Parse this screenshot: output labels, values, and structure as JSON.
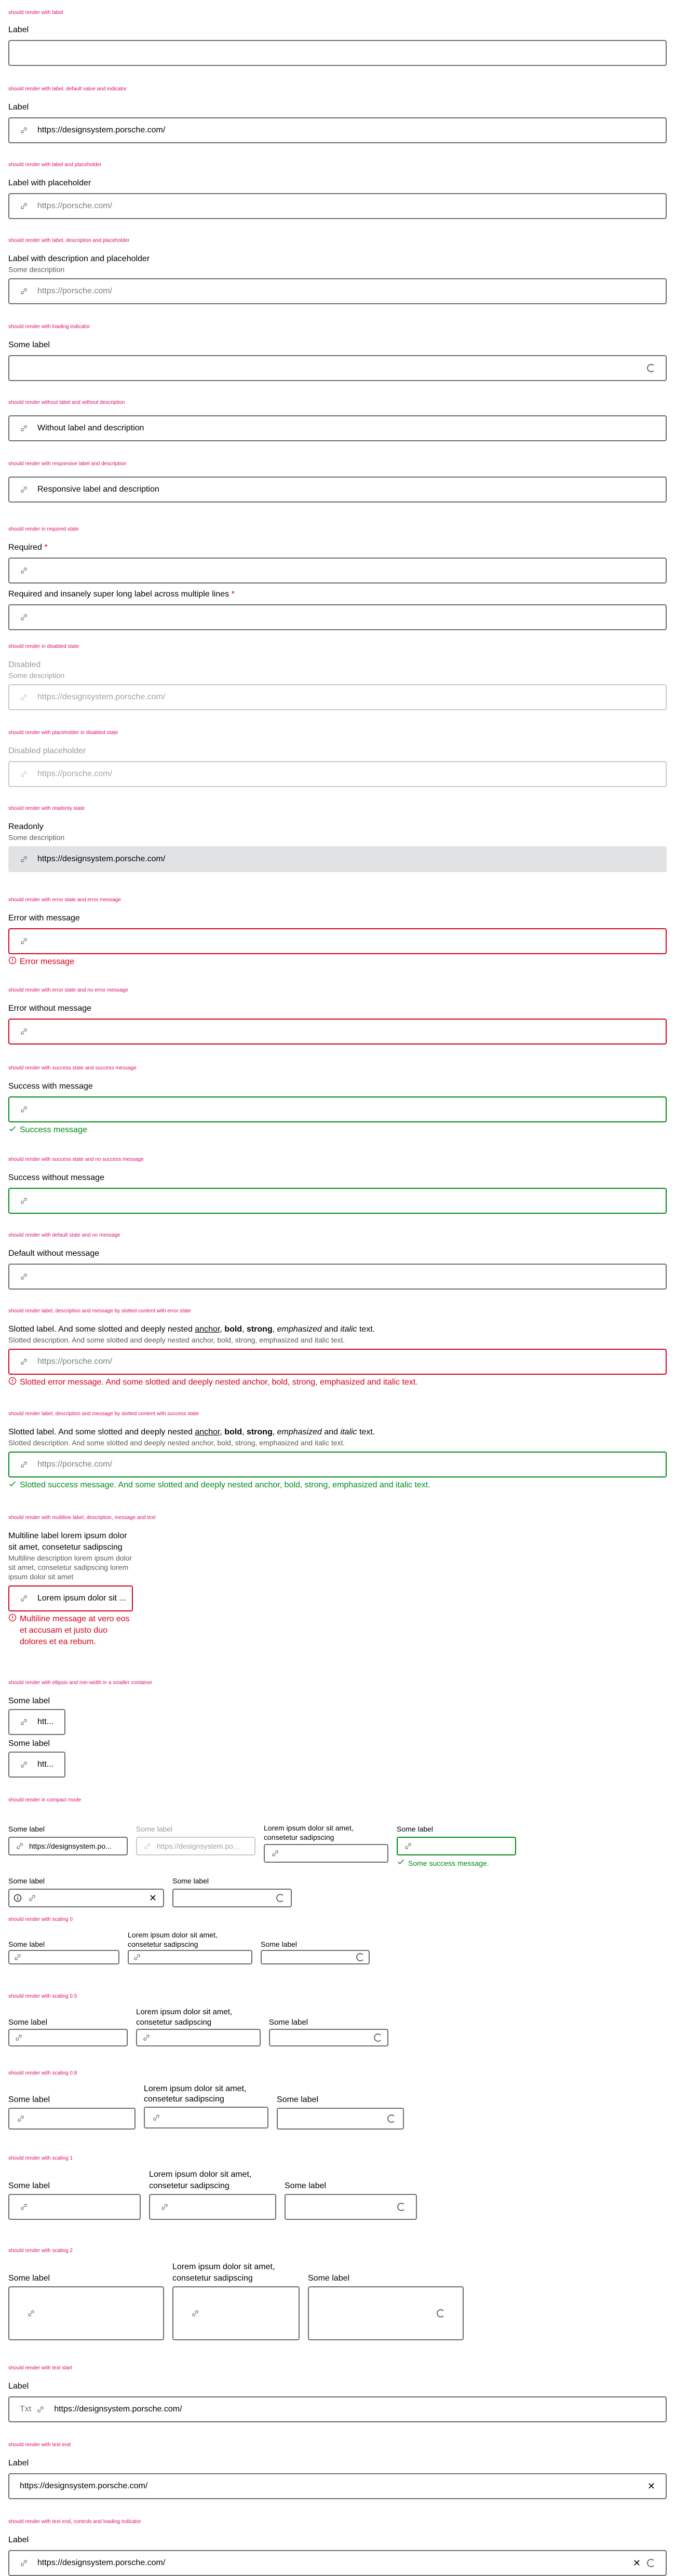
{
  "url": "https://designsystem.porsche.com/",
  "ph_url": "https://porsche.com/",
  "s1": {
    "h": "should render with label",
    "label": "Label"
  },
  "s2": {
    "h": "should render with label, default value and indicator",
    "label": "Label",
    "value": "https://designsystem.porsche.com/"
  },
  "s3": {
    "h": "should render with label and placeholder",
    "label": "Label with placeholder"
  },
  "s4": {
    "h": "should render with label, description and placeholder",
    "label": "Label with description and placeholder",
    "desc": "Some description"
  },
  "s5": {
    "h": "should render with loading indicator",
    "label": "Some label"
  },
  "s6": {
    "h": "should render without label and without description",
    "value": "Without label and description"
  },
  "s7": {
    "h": "should render with responsive label and description",
    "value": "Responsive label and description"
  },
  "s8": {
    "h": "should render in required state",
    "label1": "Required",
    "label2": "Required and insanely super long label across multiple lines",
    "star": " *"
  },
  "s9": {
    "h": "should render in disabled state",
    "label": "Disabled",
    "desc": "Some description"
  },
  "s10": {
    "h": "should render with placeholder in disabled state",
    "label": "Disabled placeholder"
  },
  "s11": {
    "h": "should render with readonly state",
    "label": "Readonly",
    "desc": "Some description"
  },
  "s12": {
    "h": "should render with error state and error message",
    "label": "Error with message",
    "msg": "Error message"
  },
  "s13": {
    "h": "should render with error state and no error message",
    "label": "Error without message"
  },
  "s14": {
    "h": "should render with success state and success message",
    "label": "Success with message",
    "msg": "Success message"
  },
  "s15": {
    "h": "should render with success state and no success message",
    "label": "Success without message"
  },
  "s16": {
    "h": "should render with default state and no message",
    "label": "Default without message"
  },
  "s17": {
    "h": "should render label, description and message by slotted content with error state",
    "label_a": "Slotted label. And some slotted and deeply nested ",
    "label_b": "anchor",
    "label_c": ", ",
    "label_d": "bold",
    "label_e": ", ",
    "label_f": "strong",
    "label_g": ", ",
    "label_h": "emphasized",
    "label_i": " and ",
    "label_j": "italic",
    "label_k": " text.",
    "desc": "Slotted description. And some slotted and deeply nested anchor, bold, strong, emphasized and italic text.",
    "msg": "Slotted error message. And some slotted and deeply nested anchor, bold, strong, emphasized and italic text."
  },
  "s18": {
    "h": "should render label, description and message by slotted content with success state",
    "msg": "Slotted success message. And some slotted and deeply nested anchor, bold, strong, emphasized and italic text."
  },
  "s19": {
    "h": "should render with multiline label, description, message and text",
    "label": "Multiline label lorem ipsum dolor sit amet, consetetur sadipscing",
    "desc": "Multiline description lorem ipsum dolor sit amet, consetetur sadipscing lorem ipsum dolor sit amet",
    "value": "Lorem ipsum dolor sit ...",
    "msg": "Multiline message at vero eos et accusam et justo duo dolores et ea rebum."
  },
  "s20": {
    "h": "should render with ellipsis and min-width in a smaller container",
    "label": "Some label",
    "value": "htt..."
  },
  "s21": {
    "h": "should render in compact mode",
    "label": "Some label",
    "long": "Lorem ipsum dolor sit amet, consetetur sadipscing",
    "value": "https://designsystem.po...",
    "ph": "https://designsystem.po...",
    "msg": "Some success message."
  },
  "s22": {
    "h": "should render with scaling 0"
  },
  "s23": {
    "h": "should render with scaling 0.5"
  },
  "s24": {
    "h": "should render with scaling 0.8"
  },
  "s25": {
    "h": "should render with scaling 1"
  },
  "s26": {
    "h": "should render with scaling 2"
  },
  "s27": {
    "h": "should render with text start",
    "label": "Label",
    "start": "Txt"
  },
  "s28": {
    "h": "should render with text end",
    "label": "Label"
  },
  "s29": {
    "h": "should render with text end, controls and loading indicator",
    "label": "Label"
  }
}
